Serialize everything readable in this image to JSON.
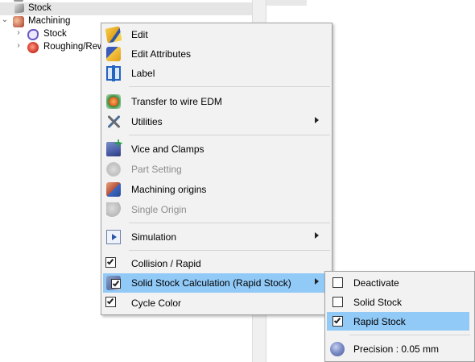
{
  "tree": {
    "items": [
      {
        "label": "Stock",
        "expander": ""
      },
      {
        "label": "Machining",
        "expander": "⌄"
      },
      {
        "label": "Stock",
        "expander": "›"
      },
      {
        "label": "Roughing/Rewc",
        "expander": "›"
      }
    ]
  },
  "menu": {
    "items": {
      "edit": "Edit",
      "edit_attributes": "Edit Attributes",
      "label": "Label",
      "transfer_wire_edm": "Transfer to wire EDM",
      "utilities": "Utilities",
      "vice_clamps": "Vice and Clamps",
      "part_setting": "Part Setting",
      "machining_origins": "Machining origins",
      "single_origin": "Single Origin",
      "simulation": "Simulation",
      "collision_rapid": "Collision / Rapid",
      "solid_stock_calc": "Solid Stock Calculation (Rapid Stock)",
      "cycle_color": "Cycle Color"
    },
    "checked": {
      "collision_rapid": true,
      "cycle_color": true
    }
  },
  "submenu": {
    "deactivate": "Deactivate",
    "solid_stock": "Solid Stock",
    "rapid_stock": "Rapid Stock",
    "precision": "Precision : 0.05 mm",
    "checked": "rapid_stock"
  },
  "colors": {
    "highlight": "#91c9f7",
    "menu_background": "#f2f2f2",
    "disabled_text": "#8d8d8d"
  }
}
